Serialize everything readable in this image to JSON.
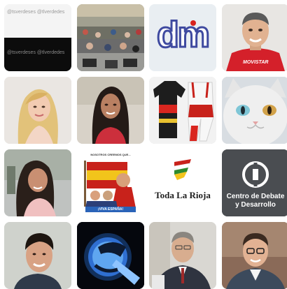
{
  "tiles": {
    "t00": {
      "handle_top": "@tsverdeses @tlverdedes",
      "handle_bottom": "@tsverdeses @tlverdedes"
    },
    "t02": {
      "logo": "dm"
    },
    "t03": {
      "shirt": "MOVISTAR"
    },
    "t21": {
      "poster_header": "NOSOTROS CREEMOS QUE...",
      "poster_footer": "¡VIVA ESPAÑA!"
    },
    "t22": {
      "name": "Toda La Rioja"
    },
    "t23": {
      "line1": "Centro de Debate",
      "line2": "y Desarrollo"
    }
  },
  "colors": {
    "page_bg": "#ffffff",
    "tile_radius_color": "#dddddd"
  }
}
